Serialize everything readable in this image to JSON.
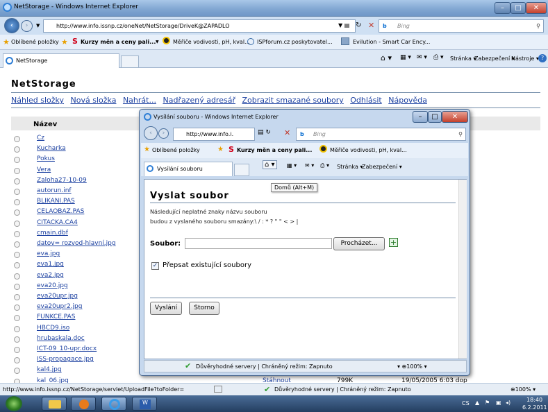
{
  "window": {
    "title": "NetStorage - Windows Internet Explorer"
  },
  "addressbar": {
    "url": "http://www.info.issnp.cz/oneNet/NetStorage/DriveK@ZAPADLO",
    "search_placeholder": "Bing"
  },
  "favorites": {
    "label": "Oblíbené položky",
    "items": [
      "Kurzy měn a ceny pali...",
      "Měřiče vodivosti, pH, kval...",
      "ISPforum.cz poskytovatel...",
      "Evilution - Smart Car Ency..."
    ]
  },
  "tab": {
    "label": "NetStorage"
  },
  "commandbar": {
    "page": "Stránka",
    "security": "Zabezpečení",
    "tools": "Nástroje"
  },
  "page": {
    "title": "NetStorage",
    "links": [
      "Náhled složky",
      "Nová složka",
      "Nahrát...",
      "Nadřazený adresář",
      "Zobrazit smazané soubory",
      "Odhlásit",
      "Nápověda"
    ],
    "column_name": "Název",
    "files": [
      "Cz",
      "Kucharka",
      "Pokus",
      "Vera",
      "Zaloha27-10-09",
      "autorun.inf",
      "BLIKANI.PAS",
      "CELAOBAZ.PAS",
      "CITACKA.CA4",
      "cmain.dbf",
      "datov= rozvod-hlavní.jpg",
      "eva.jpg",
      "eva1.jpg",
      "eva2.jpg",
      "eva20.jpg",
      "eva20upr.jpg",
      "eva20upr2.jpg",
      "FUNKCE.PAS",
      "HBCD9.iso",
      "hrubaskala.doc",
      "ICT-09_10-upr.docx",
      "ISS-propagace.jpg",
      "kal4.jpg",
      "kal_06.jpg"
    ],
    "last_row": {
      "action": "Stáhnout",
      "size": "799K",
      "date": "19/05/2005 6:03 dop"
    }
  },
  "statusbar": {
    "url": "http://www.info.issnp.cz/NetStorage/servlet/UploadFile?toFolder=",
    "security": "Důvěryhodné servery | Chráněný režim: Zapnuto",
    "zoom": "100%"
  },
  "taskbar": {
    "lang": "CS",
    "time": "18:40",
    "date": "6.2.2011"
  },
  "dialog": {
    "title": "Vysílání souboru - Windows Internet Explorer",
    "url": "http://www.info.i.",
    "search_placeholder": "Bing",
    "favorites_label": "Oblíbené položky",
    "fav1": "Kurzy měn a ceny pali...",
    "fav2": "Měřiče vodivosti, pH, kval...",
    "tab_label": "Vysílání souboru",
    "page_menu": "Stránka",
    "security_menu": "Zabezpečení",
    "tooltip": "Domů (Alt+M)",
    "heading": "Vyslat soubor",
    "note_line1": "Následující neplatné znaky názvu souboru",
    "note_line2": "budou z vyslaného souboru smazány:\\ / : * ? \" \" < > |",
    "file_label": "Soubor:",
    "file_value": "",
    "browse_button": "Procházet...",
    "overwrite_label": "Přepsat existující soubory",
    "overwrite_checked": true,
    "send_button": "Vyslání",
    "cancel_button": "Storno",
    "status": "Důvěryhodné servery | Chráněný režim: Zapnuto",
    "zoom": "100%"
  }
}
